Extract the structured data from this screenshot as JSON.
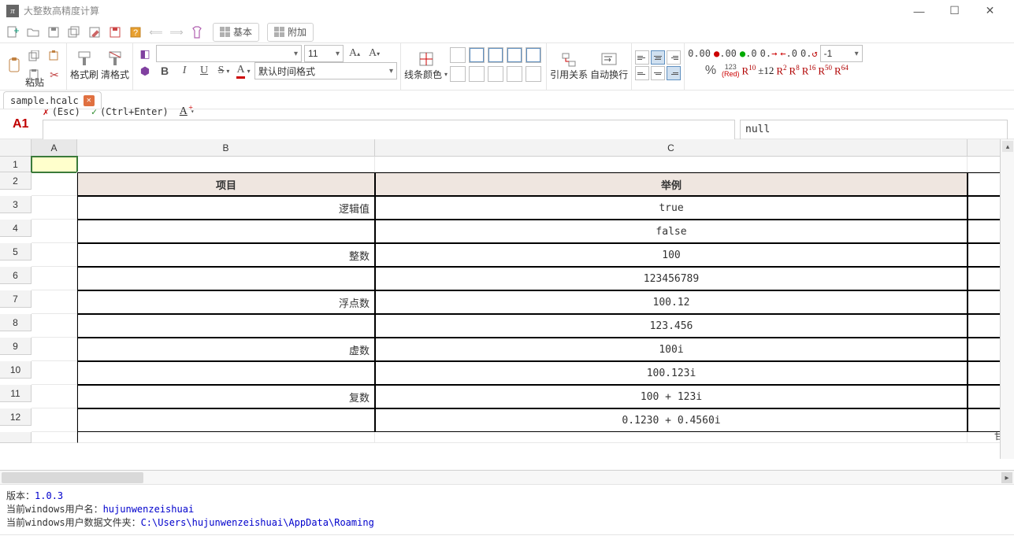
{
  "window": {
    "title": "大整数高精度计算",
    "app_icon_glyph": "π"
  },
  "toolbar_tabs": {
    "basic": "基本",
    "extra": "附加"
  },
  "ribbon": {
    "paste": "粘贴",
    "format_painter": "格式刷",
    "clear_format": "清格式",
    "font_combo": "",
    "size_combo": "11",
    "time_format": "默认时间格式",
    "line_color": "线条颜色",
    "reference": "引用关系",
    "auto_wrap": "自动换行",
    "bold": "B",
    "italic": "I",
    "underline": "U",
    "percent": "%",
    "r123": "123",
    "r_red": "(Red)",
    "rset": [
      "R",
      "R",
      "R",
      "R",
      "R",
      "R",
      "R"
    ],
    "rsup": [
      "10",
      "±12",
      "2",
      "8",
      "16",
      "50",
      "64"
    ],
    "format_combo": "-1",
    "dec_a": "0.00",
    "dec_b": ".00",
    "dec_c": ".0",
    "dec_d": "0.",
    "dec_e": ".0",
    "dec_f": "0."
  },
  "doc_tab": "sample.hcalc",
  "formula_bar": {
    "cellref": "A1",
    "esc": "(Esc)",
    "enter": "(Ctrl+Enter)",
    "result": "null"
  },
  "columns": [
    "A",
    "B",
    "C"
  ],
  "rows_count": 12,
  "grid": {
    "r1": {
      "A": "",
      "B": "",
      "C": ""
    },
    "r2": {
      "B": "项目",
      "C": "举例"
    },
    "r3": {
      "B": "逻辑值",
      "C": "true"
    },
    "r4": {
      "B": "",
      "C": "false"
    },
    "r5": {
      "B": "整数",
      "C": "100"
    },
    "r6": {
      "B": "",
      "C": "123456789"
    },
    "r7": {
      "B": "浮点数",
      "C": "100.12"
    },
    "r8": {
      "B": "",
      "C": "123.456"
    },
    "r9": {
      "B": "虚数",
      "C": "100i"
    },
    "r10": {
      "B": "",
      "C": "100.123i"
    },
    "r11": {
      "B": "复数",
      "C": "100 + 123i"
    },
    "r12": {
      "B": "",
      "C": "0.1230 + 0.4560i"
    }
  },
  "bottom_right_badge": "甘巾",
  "status": {
    "version_label": "版本：",
    "version": "1.0.3",
    "user_label": "当前windows用户名：",
    "user": "hujunwenzeishuai",
    "folder_label": "当前windows用户数据文件夹：",
    "folder": "C:\\Users\\hujunwenzeishuai\\AppData\\Roaming"
  }
}
